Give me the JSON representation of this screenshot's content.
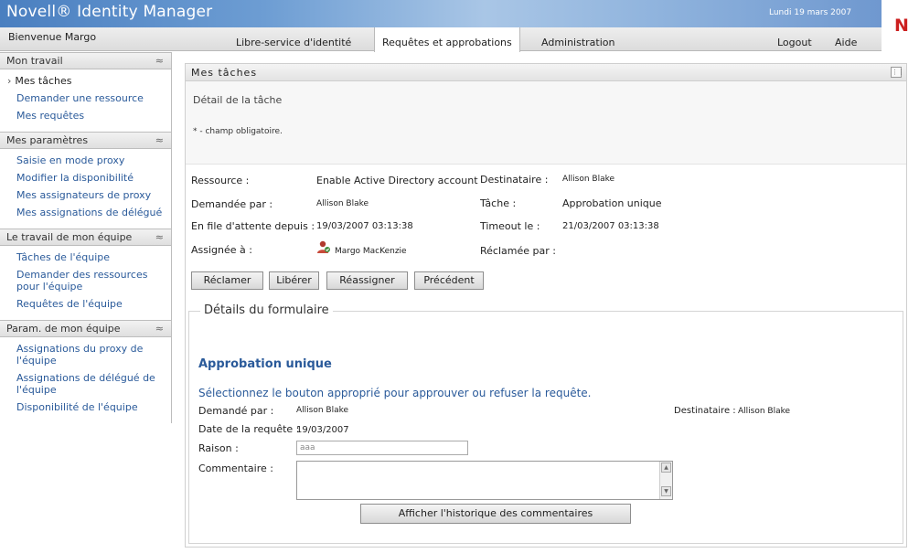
{
  "header": {
    "app_title": "Novell® Identity Manager",
    "date": "Lundi 19 mars 2007",
    "logo_letter": "N"
  },
  "nav": {
    "welcome": "Bienvenue Margo",
    "tabs": [
      {
        "label": "Libre-service d'identité",
        "active": false
      },
      {
        "label": "Requêtes et approbations",
        "active": true
      },
      {
        "label": "Administration",
        "active": false
      }
    ],
    "logout": "Logout",
    "help": "Aide"
  },
  "sidebar": {
    "collapse_glyph": "≈",
    "groups": [
      {
        "title": "Mon travail",
        "items": [
          "Mes tâches",
          "Demander une ressource",
          "Mes requêtes"
        ]
      },
      {
        "title": "Mes paramètres",
        "items": [
          "Saisie en mode proxy",
          "Modifier la disponibilité",
          "Mes assignateurs de proxy",
          "Mes assignations de délégué"
        ]
      },
      {
        "title": "Le travail de mon équipe",
        "items": [
          "Tâches de l'équipe",
          "Demander des ressources pour l'équipe",
          "Requêtes de l'équipe"
        ]
      },
      {
        "title": "Param. de mon équipe",
        "items": [
          "Assignations du proxy de l'équipe",
          "Assignations de délégué de l'équipe",
          "Disponibilité de l'équipe"
        ]
      }
    ]
  },
  "panel": {
    "title": "Mes tâches",
    "detail_heading": "Détail de la tâche",
    "required_note": "* - champ obligatoire.",
    "fields": {
      "resource_label": "Ressource :",
      "resource_value": "Enable Active Directory account",
      "recipient_label": "Destinataire :",
      "recipient_value": "Allison Blake",
      "requested_by_label": "Demandée par :",
      "requested_by_value": "Allison Blake",
      "task_label": "Tâche :",
      "task_value": "Approbation unique",
      "queued_label": "En file d'attente depuis :",
      "queued_value": "19/03/2007 03:13:38",
      "timeout_label": "Timeout le :",
      "timeout_value": "21/03/2007 03:13:38",
      "assigned_label": "Assignée à :",
      "assigned_value": "Margo MacKenzie",
      "claimed_label": "Réclamée par :"
    },
    "buttons": {
      "claim": "Réclamer",
      "release": "Libérer",
      "reassign": "Réassigner",
      "previous": "Précédent"
    },
    "form": {
      "legend": "Détails du formulaire",
      "title": "Approbation unique",
      "instructions": "Sélectionnez le bouton approprié pour approuver ou refuser la requête.",
      "requested_by_label": "Demandé par :",
      "requested_by_value": "Allison Blake",
      "recipient_label": "Destinataire :",
      "recipient_value": "Allison Blake",
      "date_label": "Date de la requête :",
      "date_value": "19/03/2007",
      "reason_label": "Raison :",
      "reason_value": "aaa",
      "comment_label": "Commentaire :",
      "history_button": "Afficher l'historique des commentaires"
    }
  }
}
